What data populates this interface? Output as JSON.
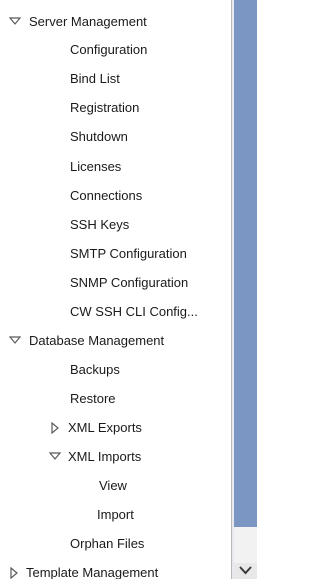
{
  "tree": {
    "server_management": {
      "label": "Server Management",
      "children": [
        "Configuration",
        "Bind List",
        "Registration",
        "Shutdown",
        "Licenses",
        "Connections",
        "SSH Keys",
        "SMTP Configuration",
        "SNMP Configuration",
        "CW SSH CLI Config..."
      ]
    },
    "database_management": {
      "label": "Database Management",
      "backups": "Backups",
      "restore": "Restore",
      "xml_exports": "XML Exports",
      "xml_imports": {
        "label": "XML Imports",
        "children": [
          "View",
          "Import"
        ]
      },
      "orphan_files": "Orphan Files"
    },
    "template_management": {
      "label": "Template Management"
    }
  },
  "colors": {
    "scroll_thumb": "#7c96c4",
    "tree_background": "#ffffff",
    "arrow": "#5b5b5b"
  }
}
